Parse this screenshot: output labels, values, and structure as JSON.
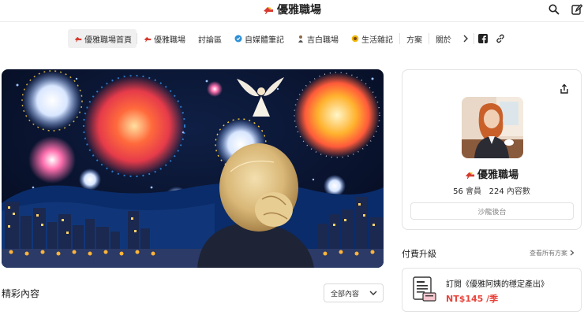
{
  "header": {
    "site_title": "優雅職場",
    "logo_icon": "high-heel-icon",
    "actions": [
      "search-icon",
      "edit-icon"
    ]
  },
  "nav": {
    "items": [
      {
        "label": "優雅職場首頁",
        "icon": "high-heel-icon",
        "active": true
      },
      {
        "label": "優雅職場",
        "icon": "high-heel-icon"
      },
      {
        "label": "討論區"
      },
      {
        "label": "自媒體筆記",
        "icon": "blue-badge-icon"
      },
      {
        "label": "吉白職場",
        "icon": "person-icon"
      },
      {
        "label": "生活雜記",
        "icon": "sunflower-icon"
      },
      {
        "label": "方案"
      },
      {
        "label": "關於"
      }
    ],
    "more_icon": "chevron-right-icon",
    "social": [
      "facebook-icon",
      "link-icon"
    ]
  },
  "banner": {
    "alt": "fireworks-felt-art"
  },
  "content": {
    "section_title": "精彩內容",
    "filter_value": "全部內容"
  },
  "sidebar": {
    "name": "優雅職場",
    "members_count": "56",
    "members_label": "會員",
    "content_count": "224",
    "content_label": "內容數",
    "salon_button": "沙龍後台"
  },
  "paid": {
    "title": "付費升級",
    "view_all": "查看所有方案",
    "plan_name": "訂閱《優雅阿姨的穩定產出》",
    "plan_price": "NT$145 /季"
  },
  "colors": {
    "accent_red": "#e8453c",
    "border": "#e3e3e3"
  }
}
